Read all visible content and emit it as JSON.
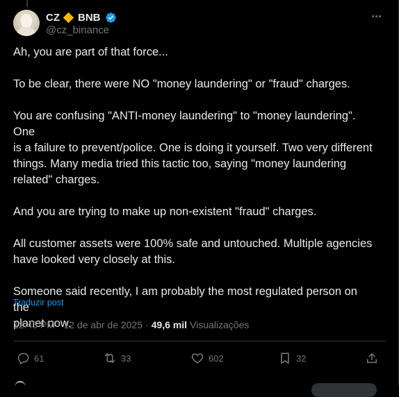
{
  "post": {
    "author": {
      "name": "CZ",
      "name_suffix": "BNB",
      "handle": "@cz_binance",
      "badge_icon": "diamond-icon",
      "badge_color": "#f0b90b",
      "verified": true,
      "verified_color": "#1d9bf0"
    },
    "more_icon": "more-icon",
    "paragraphs": [
      "Ah, you are part of that force...",
      "To be clear, there were NO \"money laundering\" or \"fraud\" charges.",
      "You are confusing \"ANTI-money laundering\" to \"money laundering\". One\nis a failure to prevent/police. One is doing it yourself. Two very different\nthings. Many media tried this tactic too, saying \"money laundering\nrelated\" charges.",
      "And you are trying to make up non-existent \"fraud\" charges.",
      "All customer assets were 100% safe and untouched. Multiple agencies\nhave looked very closely at this.",
      "Someone said recently, I am probably the most regulated person on the\nplanet now."
    ],
    "translate_label": "Traduzir post",
    "timestamp": "12:45 PM · 12 de abr de 2025",
    "separator": "·",
    "views_count": "49,6 mil",
    "views_label": "Visualizações",
    "actions": {
      "replies": "61",
      "reposts": "33",
      "likes": "602",
      "bookmarks": "32"
    }
  },
  "colors": {
    "background": "#000000",
    "text": "#e7e9ea",
    "secondary": "#71767b",
    "accent": "#1d9bf0",
    "border": "#2f3336"
  }
}
